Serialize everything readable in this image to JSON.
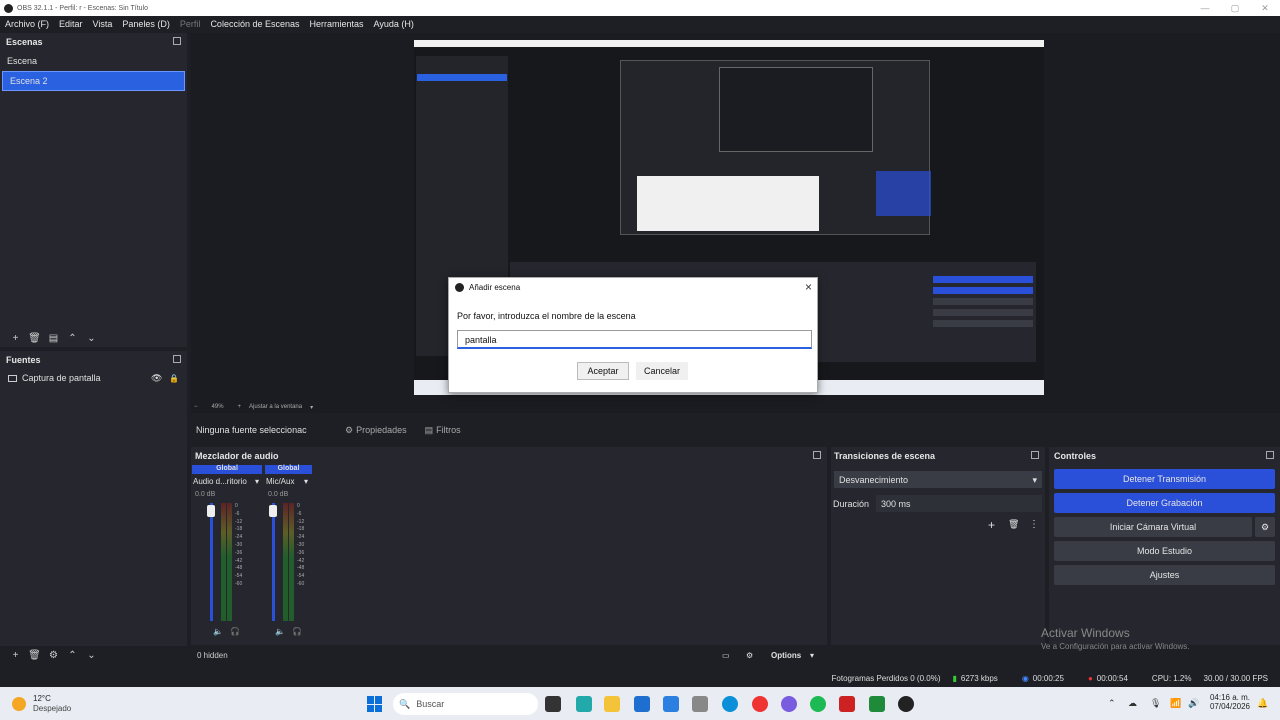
{
  "window": {
    "title": "OBS 32.1.1 - Perfil: r - Escenas: Sin Título"
  },
  "menu": [
    "Archivo (F)",
    "Editar",
    "Vista",
    "Paneles (D)",
    "Perfil",
    "Colección de Escenas",
    "Herramientas",
    "Ayuda (H)"
  ],
  "scenes": {
    "title": "Escenas",
    "items": [
      "Escena",
      "Escena 2"
    ]
  },
  "sources": {
    "title": "Fuentes",
    "items": [
      {
        "label": "Captura de pantalla"
      }
    ]
  },
  "preview_bar": {
    "zoom": "49%",
    "fit": "Ajustar a la ventana"
  },
  "source_bar": {
    "selected": "Ninguna fuente seleccionac",
    "properties": "Propiedades",
    "filters": "Filtros"
  },
  "dialog": {
    "title": "Añadir escena",
    "prompt": "Por favor, introduzca el nombre de la escena",
    "value": "pantalla",
    "ok": "Aceptar",
    "cancel": "Cancelar"
  },
  "mixer": {
    "title": "Mezclador de audio",
    "channels": [
      {
        "group": "Global",
        "name": "Audio d...ritorio",
        "db": "0.0 dB"
      },
      {
        "group": "Global",
        "name": "Mic/Aux",
        "db": "0.0 dB"
      }
    ],
    "scale": [
      "0",
      "-6",
      "-12",
      "-18",
      "-24",
      "-30",
      "-36",
      "-42",
      "-48",
      "-54",
      "-60"
    ],
    "hidden": "0 hidden",
    "options": "Options"
  },
  "transitions": {
    "title": "Transiciones de escena",
    "type": "Desvanecimiento",
    "duration_label": "Duración",
    "duration_value": "300 ms"
  },
  "controls": {
    "title": "Controles",
    "buttons": [
      {
        "label": "Detener Transmisión",
        "active": true
      },
      {
        "label": "Detener Grabación",
        "active": true
      },
      {
        "label": "Iniciar Cámara Virtual",
        "active": false
      },
      {
        "label": "Modo Estudio",
        "active": false
      },
      {
        "label": "Ajustes",
        "active": false
      }
    ]
  },
  "activation": {
    "title": "Activar Windows",
    "subtitle": "Ve a Configuración para activar Windows."
  },
  "status": {
    "dropped": "Fotogramas Perdidos 0 (0.0%)",
    "bitrate": "6273 kbps",
    "stream_time": "00:00:25",
    "rec_time": "00:00:54",
    "cpu": "CPU: 1.2%",
    "fps": "30.00 / 30.00 FPS"
  },
  "taskbar": {
    "temp": "12°C",
    "weather": "Despejado",
    "search": "Buscar",
    "time": "04:16 a. m.",
    "date": "07/04/2026"
  }
}
